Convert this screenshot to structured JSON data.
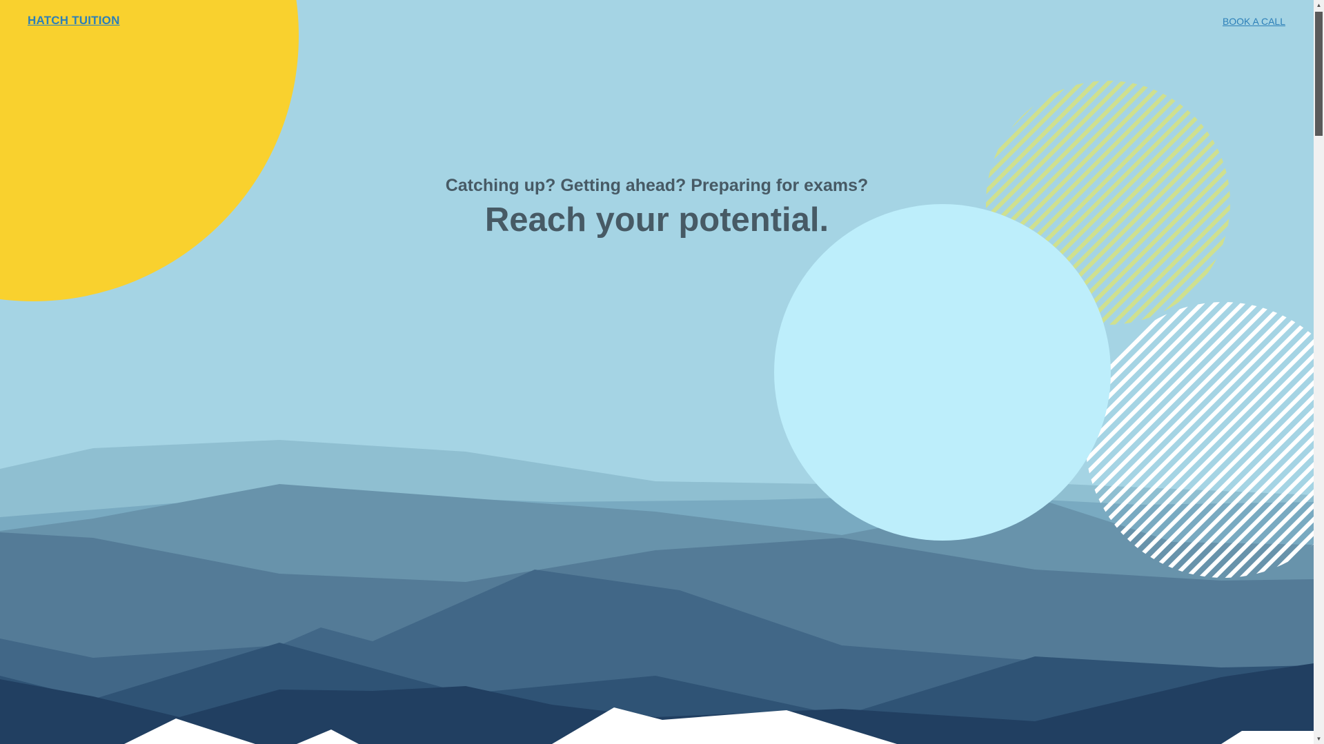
{
  "header": {
    "logo_text": "HATCH TUITION",
    "cta_label": "BOOK A CALL"
  },
  "hero": {
    "kicker": "Catching up? Getting ahead? Preparing for exams?",
    "headline": "Reach your potential."
  },
  "scrollbar": {
    "up_arrow": "▲",
    "down_arrow": "▼"
  },
  "colors": {
    "sky": "#a5d4e4",
    "sun": "#f9d12e",
    "light_circle": "#bdeefb",
    "hatched_green": "#cfe08f",
    "link": "#2c7fb8",
    "text": "#475a65"
  }
}
